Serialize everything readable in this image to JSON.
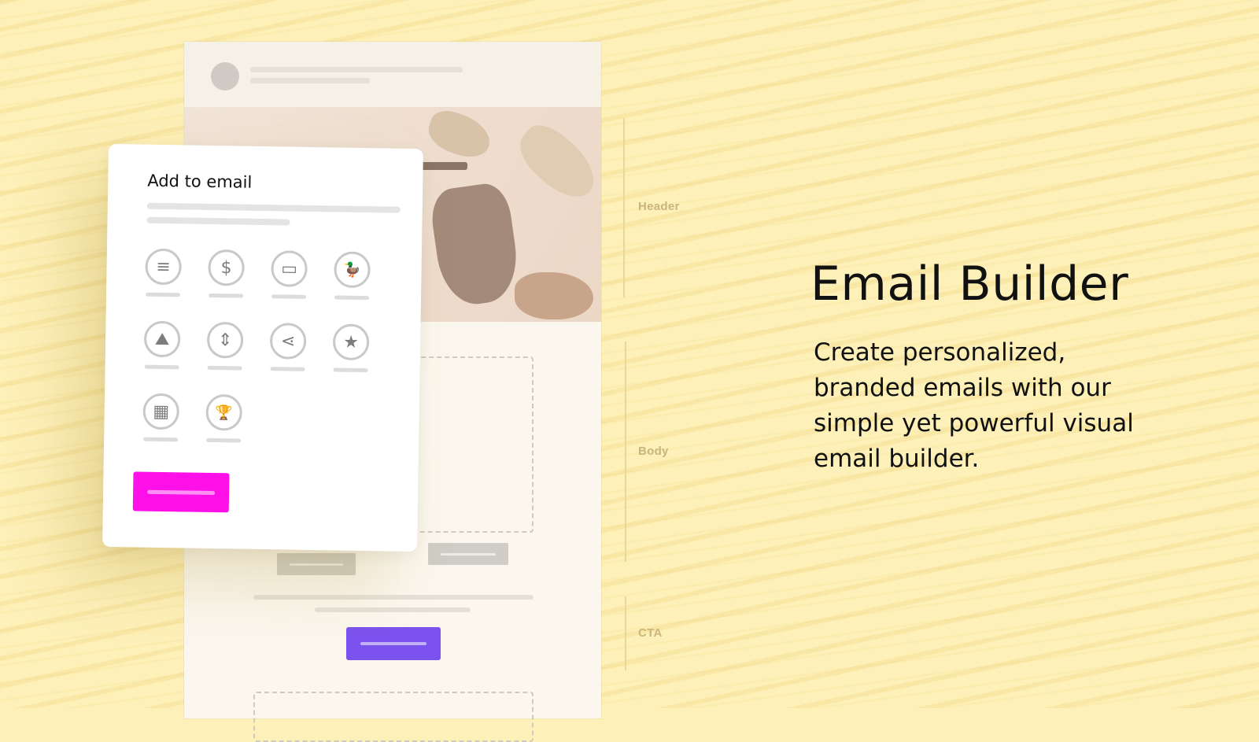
{
  "panel": {
    "title": "Add to email",
    "tiles": [
      {
        "icon": "text-block-icon",
        "glyph": "≡"
      },
      {
        "icon": "dollar-icon",
        "glyph": "$"
      },
      {
        "icon": "button-click-icon",
        "glyph": "▭"
      },
      {
        "icon": "duck-icon",
        "glyph": "🦆"
      },
      {
        "icon": "image-icon",
        "glyph": "⛰"
      },
      {
        "icon": "spacer-icon",
        "glyph": "⇕"
      },
      {
        "icon": "share-icon",
        "glyph": "⋖"
      },
      {
        "icon": "star-icon",
        "glyph": "★"
      },
      {
        "icon": "layout-icon",
        "glyph": "▦"
      },
      {
        "icon": "trophy-icon",
        "glyph": "🏆"
      }
    ]
  },
  "sections": {
    "header": "Header",
    "body": "Body",
    "cta": "CTA"
  },
  "hero": {
    "headline": "Email Builder",
    "description": "Create personalized, branded emails with our simple yet powerful visual email builder."
  },
  "colors": {
    "background": "#fdf0b8",
    "cta_purple": "#7b52ee",
    "add_button_magenta": "#ff10e8"
  }
}
